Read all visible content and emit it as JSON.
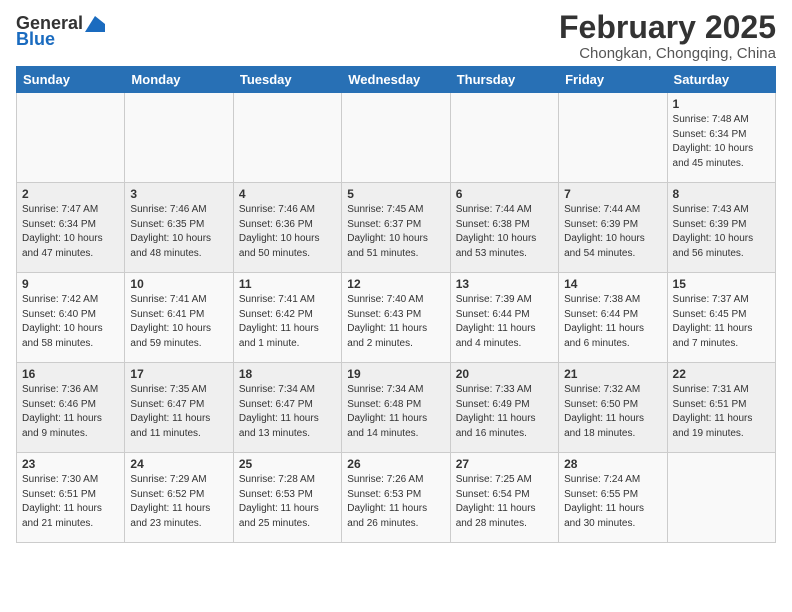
{
  "header": {
    "logo_general": "General",
    "logo_blue": "Blue",
    "month": "February 2025",
    "location": "Chongkan, Chongqing, China"
  },
  "weekdays": [
    "Sunday",
    "Monday",
    "Tuesday",
    "Wednesday",
    "Thursday",
    "Friday",
    "Saturday"
  ],
  "weeks": [
    [
      {
        "day": "",
        "info": ""
      },
      {
        "day": "",
        "info": ""
      },
      {
        "day": "",
        "info": ""
      },
      {
        "day": "",
        "info": ""
      },
      {
        "day": "",
        "info": ""
      },
      {
        "day": "",
        "info": ""
      },
      {
        "day": "1",
        "info": "Sunrise: 7:48 AM\nSunset: 6:34 PM\nDaylight: 10 hours\nand 45 minutes."
      }
    ],
    [
      {
        "day": "2",
        "info": "Sunrise: 7:47 AM\nSunset: 6:34 PM\nDaylight: 10 hours\nand 47 minutes."
      },
      {
        "day": "3",
        "info": "Sunrise: 7:46 AM\nSunset: 6:35 PM\nDaylight: 10 hours\nand 48 minutes."
      },
      {
        "day": "4",
        "info": "Sunrise: 7:46 AM\nSunset: 6:36 PM\nDaylight: 10 hours\nand 50 minutes."
      },
      {
        "day": "5",
        "info": "Sunrise: 7:45 AM\nSunset: 6:37 PM\nDaylight: 10 hours\nand 51 minutes."
      },
      {
        "day": "6",
        "info": "Sunrise: 7:44 AM\nSunset: 6:38 PM\nDaylight: 10 hours\nand 53 minutes."
      },
      {
        "day": "7",
        "info": "Sunrise: 7:44 AM\nSunset: 6:39 PM\nDaylight: 10 hours\nand 54 minutes."
      },
      {
        "day": "8",
        "info": "Sunrise: 7:43 AM\nSunset: 6:39 PM\nDaylight: 10 hours\nand 56 minutes."
      }
    ],
    [
      {
        "day": "9",
        "info": "Sunrise: 7:42 AM\nSunset: 6:40 PM\nDaylight: 10 hours\nand 58 minutes."
      },
      {
        "day": "10",
        "info": "Sunrise: 7:41 AM\nSunset: 6:41 PM\nDaylight: 10 hours\nand 59 minutes."
      },
      {
        "day": "11",
        "info": "Sunrise: 7:41 AM\nSunset: 6:42 PM\nDaylight: 11 hours\nand 1 minute."
      },
      {
        "day": "12",
        "info": "Sunrise: 7:40 AM\nSunset: 6:43 PM\nDaylight: 11 hours\nand 2 minutes."
      },
      {
        "day": "13",
        "info": "Sunrise: 7:39 AM\nSunset: 6:44 PM\nDaylight: 11 hours\nand 4 minutes."
      },
      {
        "day": "14",
        "info": "Sunrise: 7:38 AM\nSunset: 6:44 PM\nDaylight: 11 hours\nand 6 minutes."
      },
      {
        "day": "15",
        "info": "Sunrise: 7:37 AM\nSunset: 6:45 PM\nDaylight: 11 hours\nand 7 minutes."
      }
    ],
    [
      {
        "day": "16",
        "info": "Sunrise: 7:36 AM\nSunset: 6:46 PM\nDaylight: 11 hours\nand 9 minutes."
      },
      {
        "day": "17",
        "info": "Sunrise: 7:35 AM\nSunset: 6:47 PM\nDaylight: 11 hours\nand 11 minutes."
      },
      {
        "day": "18",
        "info": "Sunrise: 7:34 AM\nSunset: 6:47 PM\nDaylight: 11 hours\nand 13 minutes."
      },
      {
        "day": "19",
        "info": "Sunrise: 7:34 AM\nSunset: 6:48 PM\nDaylight: 11 hours\nand 14 minutes."
      },
      {
        "day": "20",
        "info": "Sunrise: 7:33 AM\nSunset: 6:49 PM\nDaylight: 11 hours\nand 16 minutes."
      },
      {
        "day": "21",
        "info": "Sunrise: 7:32 AM\nSunset: 6:50 PM\nDaylight: 11 hours\nand 18 minutes."
      },
      {
        "day": "22",
        "info": "Sunrise: 7:31 AM\nSunset: 6:51 PM\nDaylight: 11 hours\nand 19 minutes."
      }
    ],
    [
      {
        "day": "23",
        "info": "Sunrise: 7:30 AM\nSunset: 6:51 PM\nDaylight: 11 hours\nand 21 minutes."
      },
      {
        "day": "24",
        "info": "Sunrise: 7:29 AM\nSunset: 6:52 PM\nDaylight: 11 hours\nand 23 minutes."
      },
      {
        "day": "25",
        "info": "Sunrise: 7:28 AM\nSunset: 6:53 PM\nDaylight: 11 hours\nand 25 minutes."
      },
      {
        "day": "26",
        "info": "Sunrise: 7:26 AM\nSunset: 6:53 PM\nDaylight: 11 hours\nand 26 minutes."
      },
      {
        "day": "27",
        "info": "Sunrise: 7:25 AM\nSunset: 6:54 PM\nDaylight: 11 hours\nand 28 minutes."
      },
      {
        "day": "28",
        "info": "Sunrise: 7:24 AM\nSunset: 6:55 PM\nDaylight: 11 hours\nand 30 minutes."
      },
      {
        "day": "",
        "info": ""
      }
    ]
  ]
}
